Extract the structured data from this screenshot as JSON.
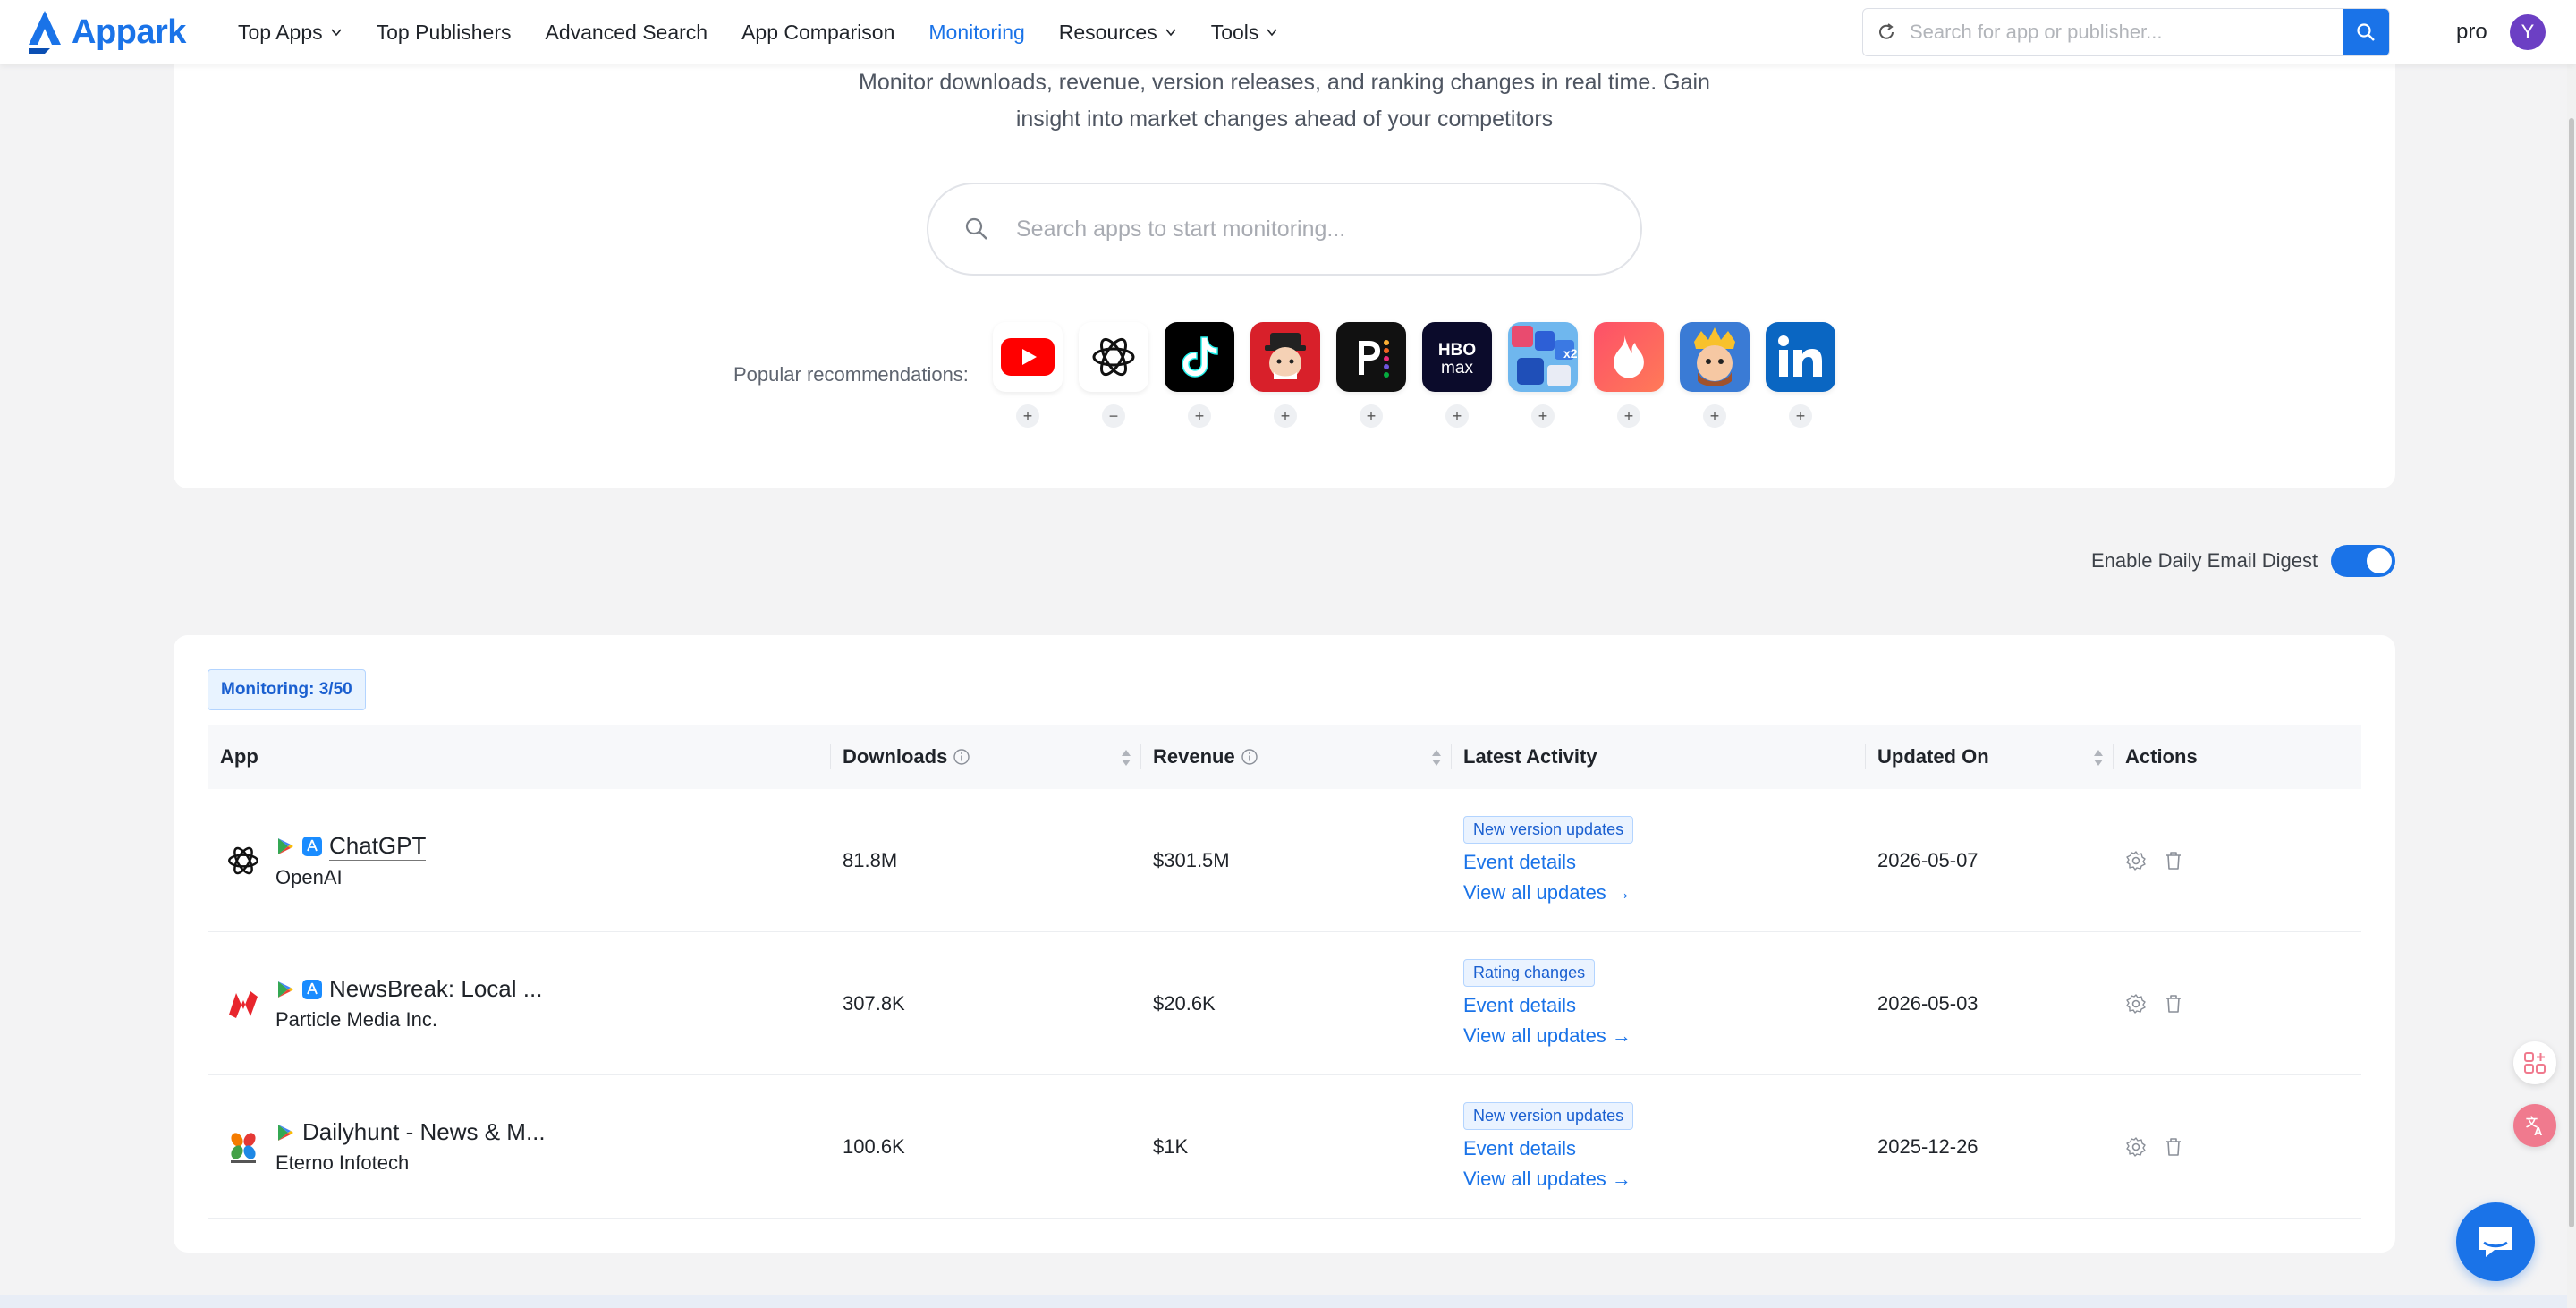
{
  "header": {
    "logo_text": "Appark",
    "nav": [
      {
        "label": "Top Apps",
        "dropdown": true,
        "active": false
      },
      {
        "label": "Top Publishers",
        "dropdown": false,
        "active": false
      },
      {
        "label": "Advanced Search",
        "dropdown": false,
        "active": false
      },
      {
        "label": "App Comparison",
        "dropdown": false,
        "active": false
      },
      {
        "label": "Monitoring",
        "dropdown": false,
        "active": true
      },
      {
        "label": "Resources",
        "dropdown": true,
        "active": false
      },
      {
        "label": "Tools",
        "dropdown": true,
        "active": false
      }
    ],
    "search_placeholder": "Search for app or publisher...",
    "plan": "pro",
    "avatar_initial": "Y"
  },
  "hero": {
    "description": "Monitor downloads, revenue, version releases, and ranking changes in real time. Gain insight into market changes ahead of your competitors",
    "search_placeholder": "Search apps to start monitoring...",
    "rec_label": "Popular recommendations:",
    "recommendations": [
      {
        "icon": "youtube-icon",
        "action": "+"
      },
      {
        "icon": "chatgpt-icon",
        "action": "−"
      },
      {
        "icon": "tiktok-icon",
        "action": "+"
      },
      {
        "icon": "monopoly-go-icon",
        "action": "+"
      },
      {
        "icon": "peacock-icon",
        "action": "+"
      },
      {
        "icon": "hbo-max-icon",
        "action": "+"
      },
      {
        "icon": "puzzle-game-icon",
        "action": "+"
      },
      {
        "icon": "tinder-icon",
        "action": "+"
      },
      {
        "icon": "royal-match-icon",
        "action": "+"
      },
      {
        "icon": "linkedin-icon",
        "action": "+"
      }
    ]
  },
  "digest": {
    "label": "Enable Daily Email Digest",
    "enabled": true
  },
  "monitoring": {
    "badge": "Monitoring: 3/50",
    "columns": {
      "app": "App",
      "downloads": "Downloads",
      "revenue": "Revenue",
      "activity": "Latest Activity",
      "updated": "Updated On",
      "actions": "Actions"
    },
    "rows": [
      {
        "name": "ChatGPT",
        "publisher": "OpenAI",
        "logo": "chatgpt-logo-icon",
        "stores": [
          "google-play-icon",
          "app-store-icon"
        ],
        "downloads": "81.8M",
        "revenue": "$301.5M",
        "tag": "New version updates",
        "event_link": "Event details",
        "all_link": "View all updates →",
        "updated": "2026-05-07"
      },
      {
        "name": "NewsBreak: Local ...",
        "publisher": "Particle Media Inc.",
        "logo": "newsbreak-logo-icon",
        "stores": [
          "google-play-icon",
          "app-store-icon"
        ],
        "downloads": "307.8K",
        "revenue": "$20.6K",
        "tag": "Rating changes",
        "event_link": "Event details",
        "all_link": "View all updates →",
        "updated": "2026-05-03"
      },
      {
        "name": "Dailyhunt - News & M...",
        "publisher": "Eterno Infotech",
        "logo": "dailyhunt-logo-icon",
        "stores": [
          "google-play-icon"
        ],
        "downloads": "100.6K",
        "revenue": "$1K",
        "tag": "New version updates",
        "event_link": "Event details",
        "all_link": "View all updates →",
        "updated": "2025-12-26"
      }
    ]
  }
}
